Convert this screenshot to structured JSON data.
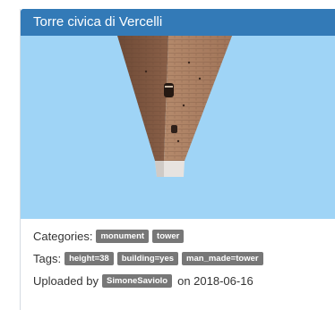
{
  "card": {
    "title": "Torre civica di Vercelli",
    "image": {
      "subject-icon": "tower-photo",
      "sky_color": "#9fd4f6"
    },
    "categories": {
      "label": "Categories:",
      "items": [
        "monument",
        "tower"
      ]
    },
    "tags": {
      "label": "Tags:",
      "items": [
        "height=38",
        "building=yes",
        "man_made=tower"
      ]
    },
    "uploaded": {
      "prefix": "Uploaded by",
      "user": "SimoneSaviolo",
      "suffix": "on 2018-06-16"
    }
  },
  "colors": {
    "header_bg": "#337ab7",
    "label_bg": "#777777"
  }
}
